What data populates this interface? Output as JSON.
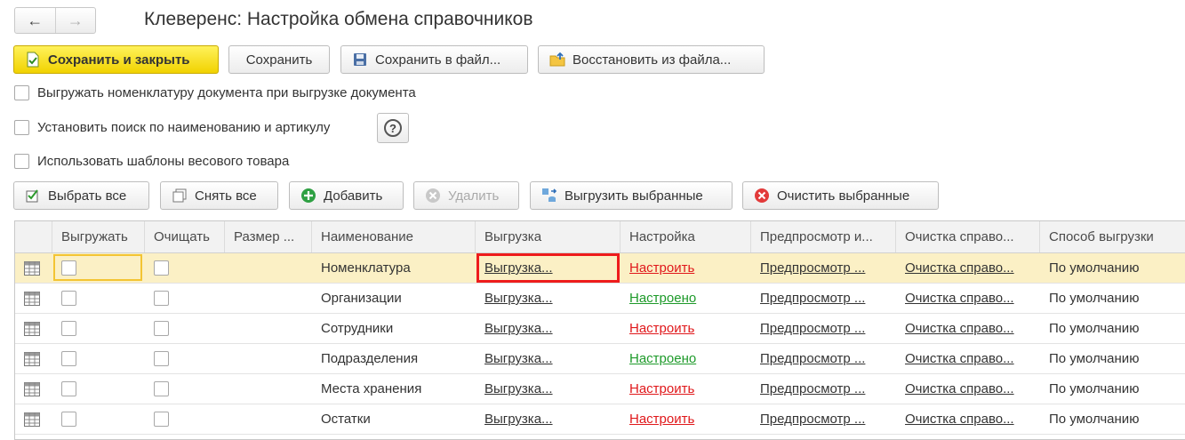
{
  "window": {
    "title": "Клеверенс: Настройка обмена справочников"
  },
  "nav": {
    "back": "back-arrow",
    "forward": "forward-arrow"
  },
  "toolbar": {
    "save_close": "Сохранить и закрыть",
    "save": "Сохранить",
    "save_file": "Сохранить в файл...",
    "restore_file": "Восстановить из файла..."
  },
  "options": {
    "export_nomenclature": "Выгружать номенклатуру документа при выгрузке документа",
    "search_by_name": "Установить поиск по наименованию и артикулу",
    "weight_templates": "Использовать шаблоны весового товара",
    "help_symbol": "?"
  },
  "actions": {
    "select_all": "Выбрать все",
    "deselect_all": "Снять все",
    "add": "Добавить",
    "delete": "Удалить",
    "export_selected": "Выгрузить выбранные",
    "clear_selected": "Очистить выбранные"
  },
  "table": {
    "columns": [
      "Выгружать",
      "Очищать",
      "Размер ...",
      "Наименование",
      "Выгрузка",
      "Настройка",
      "Предпросмотр и...",
      "Очистка справо...",
      "Способ выгрузки"
    ],
    "rows": [
      {
        "name": "Номенклатура",
        "export": "Выгрузка...",
        "setup": "Настроить",
        "preview": "Предпросмотр ...",
        "clear": "Очистка справо...",
        "method": "По умолчанию"
      },
      {
        "name": "Организации",
        "export": "Выгрузка...",
        "setup": "Настроено",
        "preview": "Предпросмотр ...",
        "clear": "Очистка справо...",
        "method": "По умолчанию"
      },
      {
        "name": "Сотрудники",
        "export": "Выгрузка...",
        "setup": "Настроить",
        "preview": "Предпросмотр ...",
        "clear": "Очистка справо...",
        "method": "По умолчанию"
      },
      {
        "name": "Подразделения",
        "export": "Выгрузка...",
        "setup": "Настроено",
        "preview": "Предпросмотр ...",
        "clear": "Очистка справо...",
        "method": "По умолчанию"
      },
      {
        "name": "Места хранения",
        "export": "Выгрузка...",
        "setup": "Настроить",
        "preview": "Предпросмотр ...",
        "clear": "Очистка справо...",
        "method": "По умолчанию"
      },
      {
        "name": "Остатки",
        "export": "Выгрузка...",
        "setup": "Настроить",
        "preview": "Предпросмотр ...",
        "clear": "Очистка справо...",
        "method": "По умолчанию"
      }
    ]
  },
  "colors": {
    "accent_yellow": "#f5d90a",
    "link_red": "#e0181b",
    "link_green": "#1e9a2a",
    "highlight": "#ee1c1c",
    "selected_row": "#fbf0c5"
  }
}
